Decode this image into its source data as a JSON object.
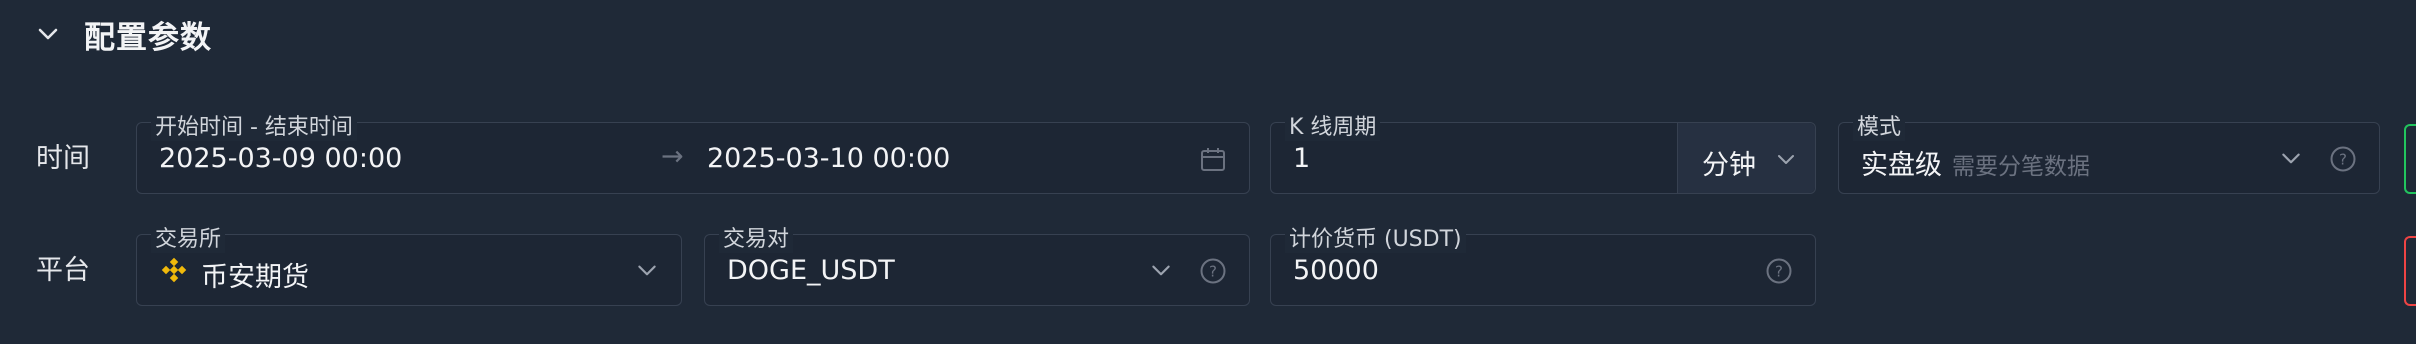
{
  "header": {
    "title": "配置参数"
  },
  "rows": {
    "time_label": "时间",
    "platform_label": "平台"
  },
  "time_range": {
    "label": "开始时间 - 结束时间",
    "start": "2025-03-09 00:00",
    "end": "2025-03-10 00:00",
    "separator": "→"
  },
  "kline": {
    "label": "K 线周期",
    "value": "1",
    "unit": "分钟"
  },
  "mode": {
    "label": "模式",
    "value": "实盘级",
    "hint": "需要分笔数据"
  },
  "exchange": {
    "label": "交易所",
    "value": "币安期货"
  },
  "pair": {
    "label": "交易对",
    "value": "DOGE_USDT"
  },
  "quote": {
    "label": "计价货币 (USDT)",
    "value": "50000"
  },
  "colors": {
    "background": "#1f2937",
    "border": "#374151",
    "binance": "#f0b90b",
    "edge_green": "#22c55e",
    "edge_red": "#ef4444"
  },
  "icons": [
    "chevron-down-icon",
    "calendar-icon",
    "help-circle-icon",
    "binance-logo"
  ]
}
